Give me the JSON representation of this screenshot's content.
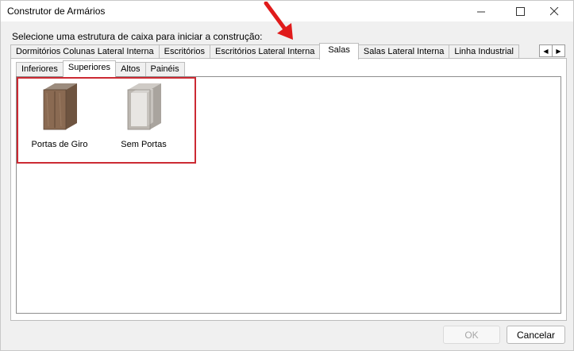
{
  "window": {
    "title": "Construtor de Armários",
    "controls": {
      "minimize": "—",
      "maximize": "☐",
      "close": "✕"
    }
  },
  "instruction": "Selecione uma estrutura de caixa para iniciar a construção:",
  "main_tabs": [
    {
      "label": "Dormitórios Colunas Lateral Interna",
      "active": false
    },
    {
      "label": "Escritórios",
      "active": false
    },
    {
      "label": "Escritórios Lateral Interna",
      "active": false
    },
    {
      "label": "Salas",
      "active": true
    },
    {
      "label": "Salas Lateral Interna",
      "active": false
    },
    {
      "label": "Linha Industrial",
      "active": false
    }
  ],
  "tab_scroll": {
    "left": "◀",
    "right": "▶"
  },
  "sub_tabs": [
    {
      "label": "Inferiores",
      "active": false
    },
    {
      "label": "Superiores",
      "active": true
    },
    {
      "label": "Altos",
      "active": false
    },
    {
      "label": "Painéis",
      "active": false
    }
  ],
  "items": [
    {
      "label": "Portas de Giro",
      "icon": "cabinet-doors-icon"
    },
    {
      "label": "Sem Portas",
      "icon": "cabinet-open-icon"
    }
  ],
  "buttons": {
    "ok": "OK",
    "ok_disabled": true,
    "cancel": "Cancelar"
  },
  "colors": {
    "highlight": "#cc2a33",
    "arrow": "#e01b1b",
    "wood": "#8a6a52",
    "cabinet_gray": "#b8b4ae"
  }
}
